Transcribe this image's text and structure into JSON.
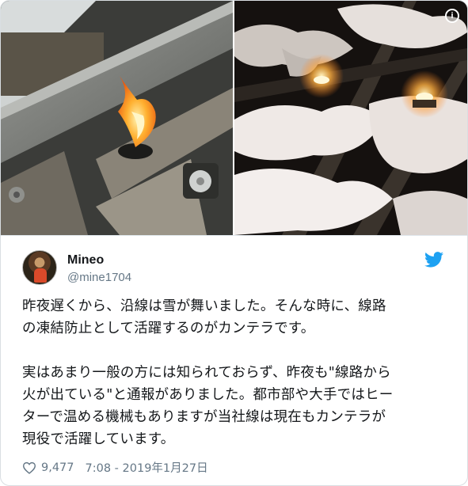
{
  "media": {
    "info_icon": "info-icon",
    "info_glyph": "i",
    "photos": [
      {
        "name": "rail-flame-photo"
      },
      {
        "name": "snowy-track-lanterns-photo"
      }
    ]
  },
  "tweet": {
    "display_name": "Mineo",
    "handle": "@mine1704",
    "brand_icon": "twitter-bird-icon",
    "brand_color": "#1da1f2",
    "text_lines": [
      "昨夜遅くから、沿線は雪が舞いました。そんな時に、線路",
      "の凍結防止として活躍するのがカンテラです。",
      "",
      "実はあまり一般の方には知られておらず、昨夜も\"線路から",
      "火が出ている\"と通報がありました。都市部や大手ではヒー",
      "ターで温める機械もありますが当社線は現在もカンテラが",
      "現役で活躍しています。"
    ],
    "likes": "9,477",
    "timestamp": "7:08 - 2019年1月27日",
    "heart_icon": "heart-icon"
  }
}
